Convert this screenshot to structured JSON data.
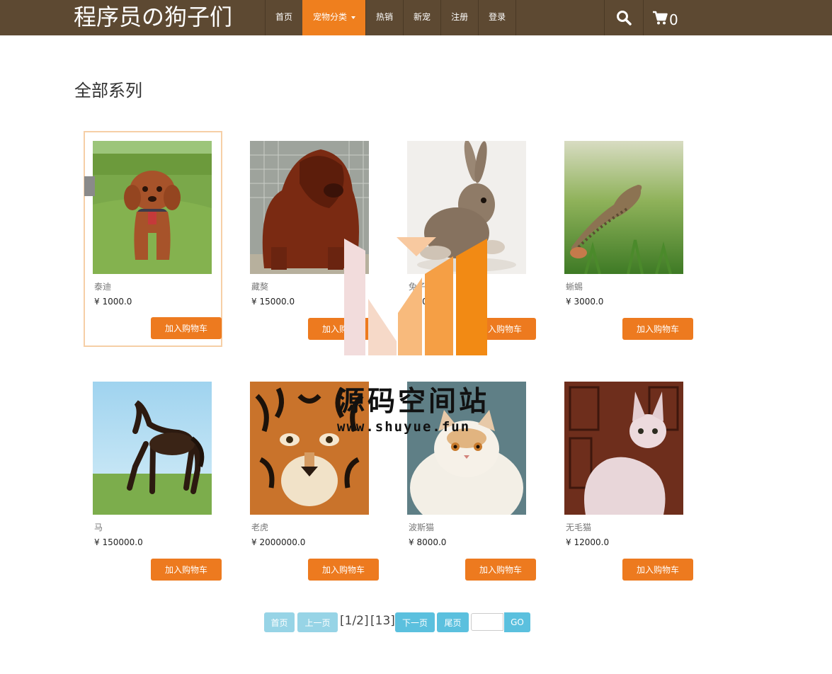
{
  "navbar": {
    "brand": "程序员の狗子们",
    "items": [
      {
        "label": "首页"
      },
      {
        "label": "宠物分类"
      },
      {
        "label": "热销"
      },
      {
        "label": "新宠"
      },
      {
        "label": "注册"
      },
      {
        "label": "登录"
      }
    ],
    "cart_count": "0",
    "colors": {
      "bar": "#5d4932",
      "active": "#ef7f1e"
    },
    "icons": [
      "search-icon",
      "cart-icon"
    ]
  },
  "section_title": "全部系列",
  "products": [
    {
      "name": "泰迪",
      "price": "¥ 1000.0",
      "button": "加入购物车",
      "image": "poodle-photo"
    },
    {
      "name": "藏獒",
      "price": "¥ 15000.0",
      "button": "加入购物车",
      "image": "mastiff-photo"
    },
    {
      "name": "兔子",
      "price": "¥ 600.0",
      "button": "加入购物车",
      "image": "rabbit-photo"
    },
    {
      "name": "蜥蜴",
      "price": "¥ 3000.0",
      "button": "加入购物车",
      "image": "lizard-photo"
    },
    {
      "name": "马",
      "price": "¥ 150000.0",
      "button": "加入购物车",
      "image": "horse-photo"
    },
    {
      "name": "老虎",
      "price": "¥ 2000000.0",
      "button": "加入购物车",
      "image": "tiger-photo"
    },
    {
      "name": "波斯猫",
      "price": "¥ 8000.0",
      "button": "加入购物车",
      "image": "persian-cat-photo"
    },
    {
      "name": "无毛猫",
      "price": "¥ 12000.0",
      "button": "加入购物车",
      "image": "sphynx-cat-photo"
    }
  ],
  "pager": {
    "first": "首页",
    "prev": "上一页",
    "page_info": "[1/2]",
    "total": "[13]",
    "next": "下一页",
    "last": "尾页",
    "go": "GO",
    "input_value": ""
  },
  "watermark": {
    "title": "源码空间站",
    "url": "www.shuyue.fun"
  }
}
